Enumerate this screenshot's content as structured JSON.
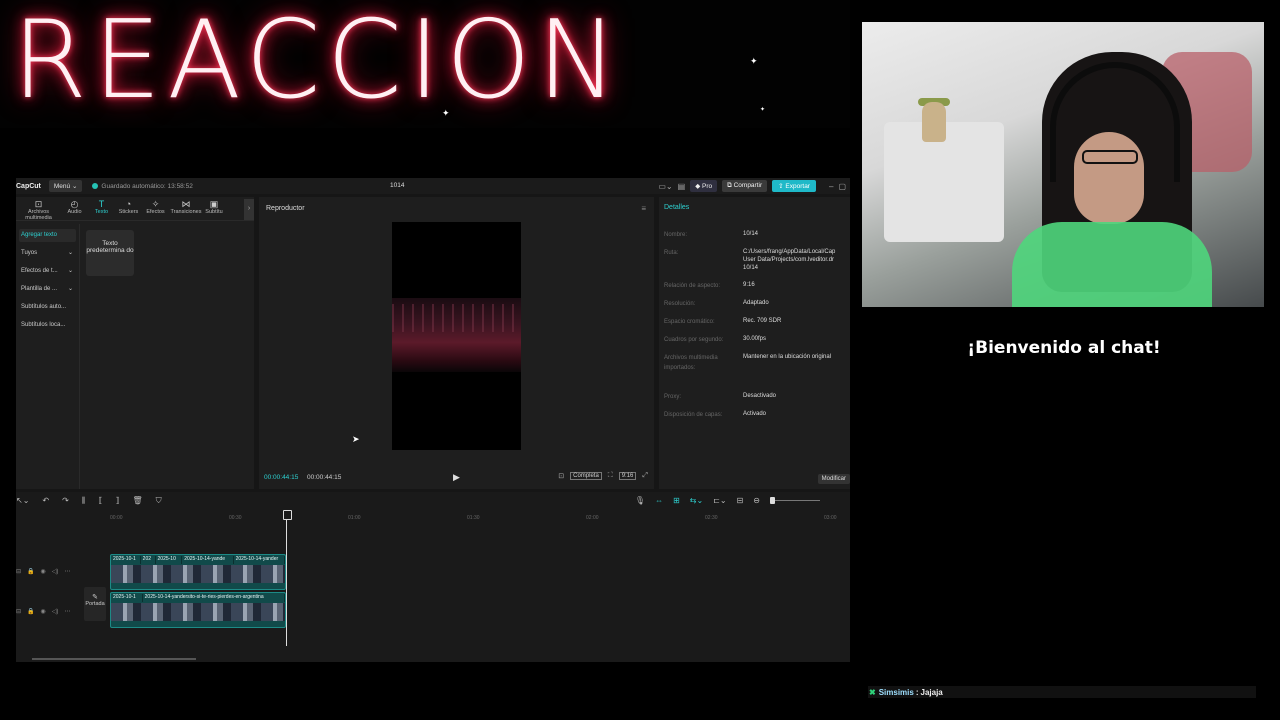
{
  "banner": {
    "title": "REACCION"
  },
  "capcut": {
    "logo": "CapCut",
    "menu_label": "Menú ⌄",
    "autosave": "Guardado automático: 13:58:52",
    "project_name": "1014",
    "pro_label": "Pro",
    "share_label": "Compartir",
    "export_label": "Exportar",
    "tools": [
      {
        "label": "Archivos multimedia",
        "icon": "media-icon"
      },
      {
        "label": "Audio",
        "icon": "audio-icon"
      },
      {
        "label": "Texto",
        "icon": "text-icon"
      },
      {
        "label": "Stickers",
        "icon": "stickers-icon"
      },
      {
        "label": "Efectos",
        "icon": "effects-icon"
      },
      {
        "label": "Transiciones",
        "icon": "transitions-icon"
      },
      {
        "label": "Subtítu",
        "icon": "subtitles-icon"
      }
    ],
    "side_items": [
      "Agregar texto",
      "Tuyos",
      "Efectos de t...",
      "Plantilla de ...",
      "Subtítulos auto...",
      "Subtítulos loca..."
    ],
    "text_card": "Texto predetermina do",
    "player": {
      "title": "Reproductor",
      "current_time": "00:00:44:15",
      "total_time": "00:00:44:15",
      "complete_label": "Completa",
      "ratio_label": "9:16"
    },
    "details": {
      "tab": "Detalles",
      "rows": [
        {
          "label": "Nombre:",
          "value": "10/14"
        },
        {
          "label": "Ruta:",
          "value": "C:/Users/frang/AppData/Local/Cap\nUser Data/Projects/com.lveditor.dr\n10/14"
        },
        {
          "label": "Relación de aspecto:",
          "value": "9:16"
        },
        {
          "label": "Resolución:",
          "value": "Adaptado"
        },
        {
          "label": "Espacio cromático:",
          "value": "Rec. 709 SDR"
        },
        {
          "label": "Cuadros por segundo:",
          "value": "30.00fps"
        },
        {
          "label": "Archivos multimedia importados:",
          "value": "Mantener en la ubicación original"
        },
        {
          "label": "Proxy:",
          "value": "Desactivado"
        },
        {
          "label": "Disposición de capas:",
          "value": "Activado"
        }
      ],
      "modify_label": "Modificar"
    },
    "timeline": {
      "ticks": [
        "00:00",
        "00:30",
        "01:00",
        "01:30",
        "02:00",
        "02:30",
        "03:00"
      ],
      "cover_label": "Portada",
      "track1_clips": [
        "2025-10-1",
        "202",
        "2025-10",
        "2025-10-14-yande",
        "2025-10-14-yander"
      ],
      "track2_clips": [
        "2025-10-1",
        "2025-10-14-yandersito-si-te-ries-pierdes-en-argentina"
      ]
    }
  },
  "chat": {
    "welcome": "¡Bienvenido al chat!",
    "messages": [
      {
        "badge": "✖",
        "user": "Simsimis",
        "separator": ":",
        "text": "Jajaja"
      }
    ]
  }
}
